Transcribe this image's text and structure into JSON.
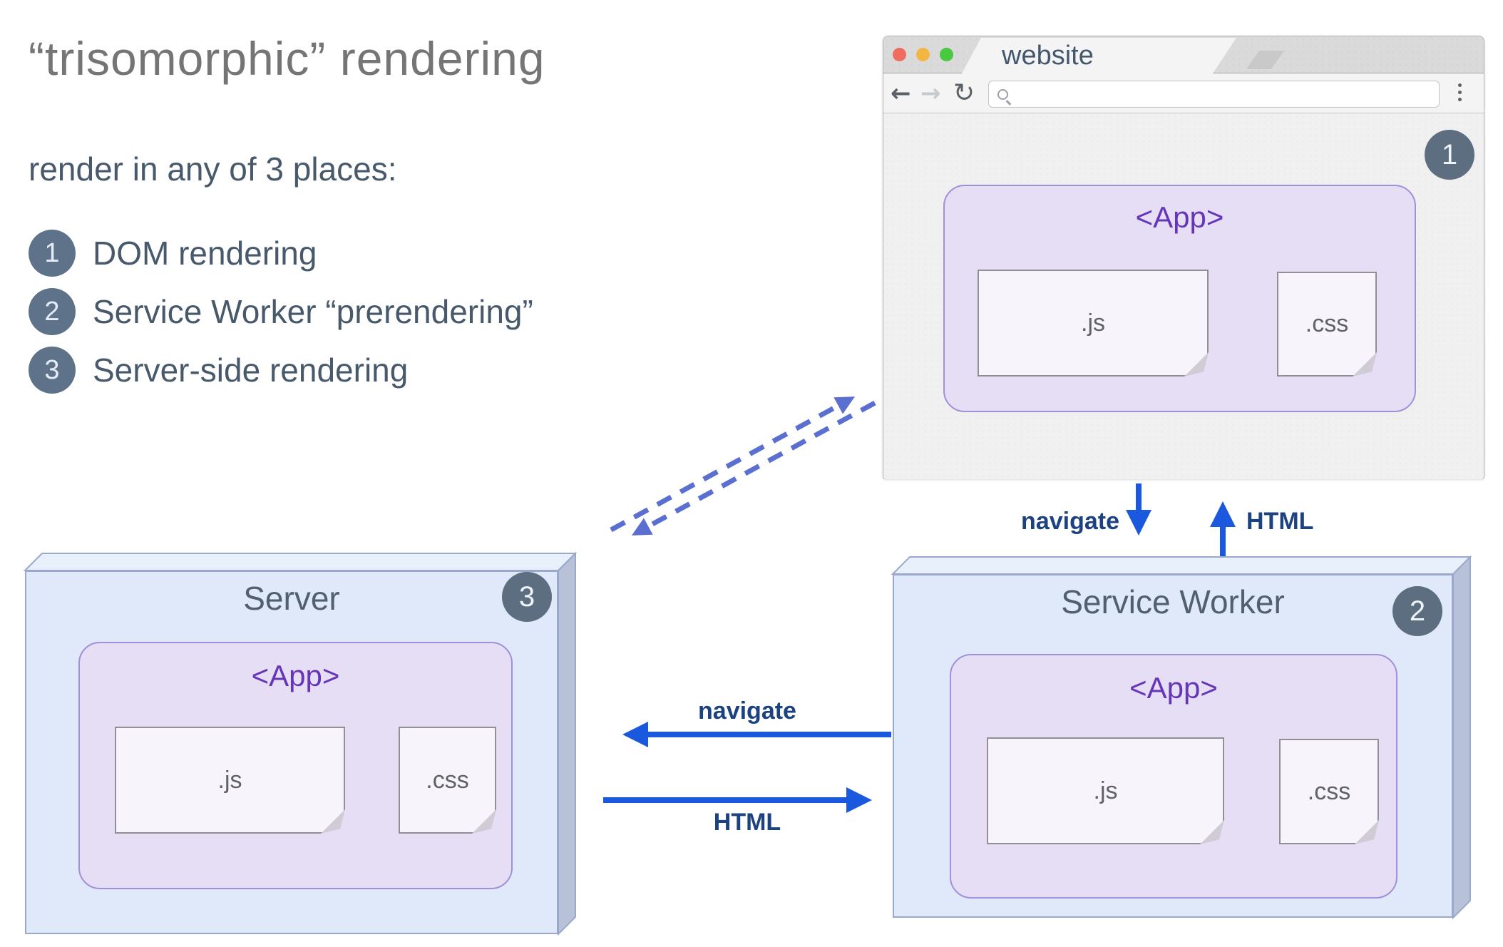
{
  "intro": {
    "title": "“trisomorphic” rendering",
    "subtitle": "render in any of 3 places:",
    "items": [
      {
        "num": "1",
        "label": "DOM rendering"
      },
      {
        "num": "2",
        "label": "Service Worker “prerendering”"
      },
      {
        "num": "3",
        "label": "Server-side rendering"
      }
    ]
  },
  "browser": {
    "tab_title": "website",
    "url_value": "",
    "badge": "1",
    "app_label": "<App>",
    "js_label": ".js",
    "css_label": ".css"
  },
  "service_worker": {
    "title": "Service Worker",
    "badge": "2",
    "app_label": "<App>",
    "js_label": ".js",
    "css_label": ".css"
  },
  "server": {
    "title": "Server",
    "badge": "3",
    "app_label": "<App>",
    "js_label": ".js",
    "css_label": ".css"
  },
  "arrows": {
    "browser_sw_down_label": "navigate",
    "browser_sw_up_label": "HTML",
    "sw_server_left_label": "navigate",
    "sw_server_right_label": "HTML"
  },
  "colors": {
    "arrow_blue": "#1a58dd",
    "dashed_blue": "#5b6fd1",
    "badge_slate": "#5d6e80",
    "app_purple": "#6636b8",
    "box_blue_fill": "#dfe9fa",
    "app_lavender_fill": "#e5def4"
  }
}
